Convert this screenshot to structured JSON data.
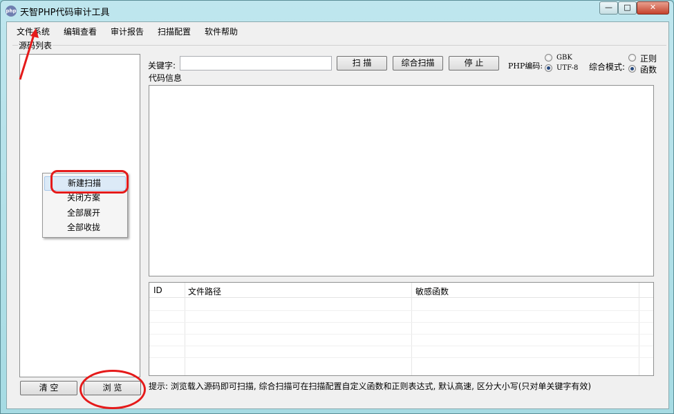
{
  "window": {
    "title": "天智PHP代码审计工具",
    "icon_text": "php",
    "controls": {
      "minimize": "—",
      "maximize": "□",
      "close": "✕"
    }
  },
  "menu": [
    "文件系统",
    "编辑查看",
    "审计报告",
    "扫描配置",
    "软件帮助"
  ],
  "source_panel": {
    "label": "源码列表"
  },
  "buttons": {
    "clear": "清 空",
    "browse": "浏 览",
    "scan": "扫 描",
    "combo_scan": "综合扫描",
    "stop": "停 止"
  },
  "keyword": {
    "label": "关键字:",
    "value": ""
  },
  "encoding": {
    "label": "PHP编码:",
    "options": [
      "GBK",
      "UTF-8"
    ],
    "selected": "UTF-8"
  },
  "mode": {
    "label": "综合模式:",
    "options": [
      "正则",
      "函数"
    ],
    "selected": "函数"
  },
  "code_info": {
    "label": "代码信息"
  },
  "results_table": {
    "columns": [
      "ID",
      "文件路径",
      "敏感函数"
    ],
    "rows": []
  },
  "tip": "提示: 浏览载入源码即可扫描, 综合扫描可在扫描配置自定义函数和正则表达式, 默认高速, 区分大小写(只对单关键字有效)",
  "context_menu": {
    "items": [
      "新建扫描",
      "关闭方案",
      "全部展开",
      "全部收拢"
    ],
    "highlighted": "新建扫描"
  },
  "colors": {
    "annotation": "#e51a1a",
    "titlebar": "#a6dbe3",
    "highlight": "#dceaf7"
  }
}
